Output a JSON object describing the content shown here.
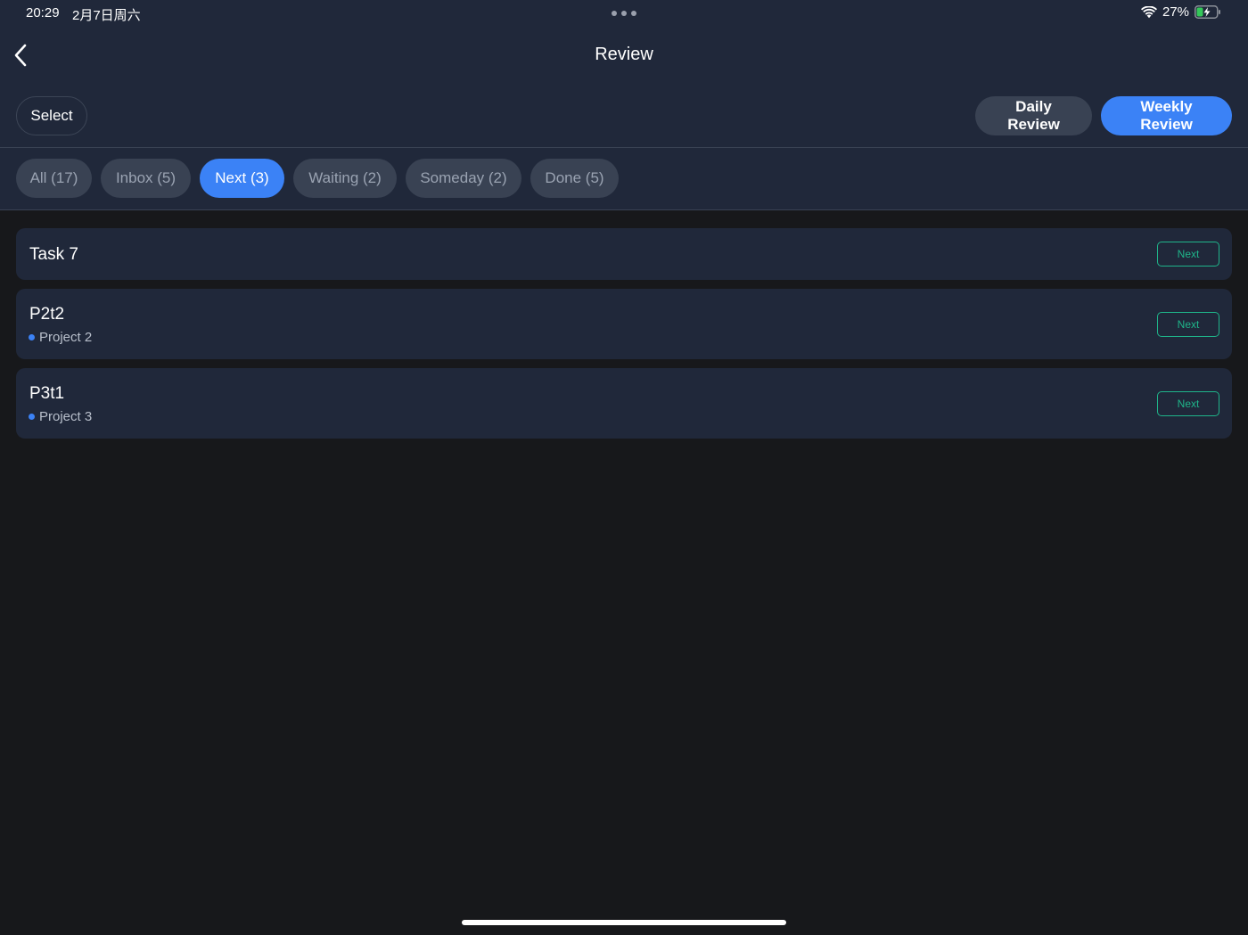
{
  "status_bar": {
    "time": "20:29",
    "date": "2月7日周六",
    "battery": "27%",
    "wifi_icon": "wifi-icon",
    "battery_icon": "battery-charging-icon"
  },
  "nav": {
    "title": "Review",
    "back_icon": "chevron-left-icon"
  },
  "toolbar": {
    "select_label": "Select",
    "daily_review_label": "Daily Review",
    "weekly_review_label": "Weekly Review",
    "active_review": "Weekly Review"
  },
  "tabs": [
    {
      "label": "All (17)",
      "active": false
    },
    {
      "label": "Inbox (5)",
      "active": false
    },
    {
      "label": "Next (3)",
      "active": true
    },
    {
      "label": "Waiting (2)",
      "active": false
    },
    {
      "label": "Someday (2)",
      "active": false
    },
    {
      "label": "Done (5)",
      "active": false
    }
  ],
  "tasks": [
    {
      "title": "Task 7",
      "project": null,
      "status": "Next"
    },
    {
      "title": "P2t2",
      "project": "Project 2",
      "status": "Next"
    },
    {
      "title": "P3t1",
      "project": "Project 3",
      "status": "Next"
    }
  ],
  "colors": {
    "accent": "#3b82f6",
    "status_next": "#1fb58a",
    "header_bg": "#20283a",
    "page_bg": "#17181b"
  }
}
